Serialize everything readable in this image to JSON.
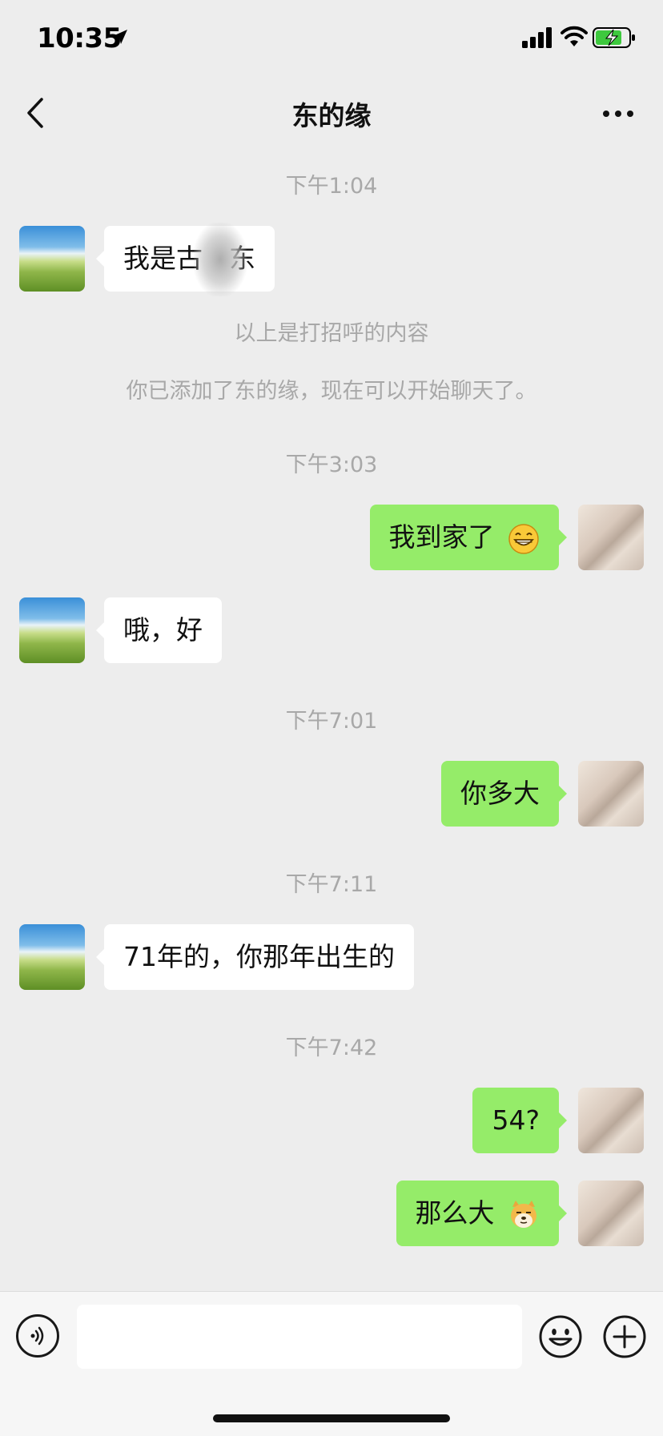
{
  "status_bar": {
    "time": "10:35"
  },
  "header": {
    "title": "东的缘"
  },
  "chat": {
    "timestamps": [
      "下午1:04",
      "下午3:03",
      "下午7:01",
      "下午7:11",
      "下午7:42"
    ],
    "system": {
      "greeting_note": "以上是打招呼的内容",
      "added_note": "你已添加了东的缘，现在可以开始聊天了。"
    },
    "messages": {
      "m1": "我是古　东",
      "m2": "我到家了",
      "m3": "哦，好",
      "m4": "你多大",
      "m5": "71年的，你那年出生的",
      "m6": "54?",
      "m7": "那么大"
    }
  },
  "input": {
    "placeholder": ""
  },
  "colors": {
    "background": "#ededed",
    "bubble_self": "#95ec69",
    "bubble_other": "#ffffff",
    "system_text": "#a8a8a8"
  },
  "icons": [
    "location-arrow-icon",
    "signal-icon",
    "wifi-icon",
    "battery-charging-icon",
    "back-chevron-icon",
    "more-dots-icon",
    "voice-icon",
    "emoji-icon",
    "plus-icon",
    "grin-emoji-icon",
    "doge-emoji-icon"
  ]
}
